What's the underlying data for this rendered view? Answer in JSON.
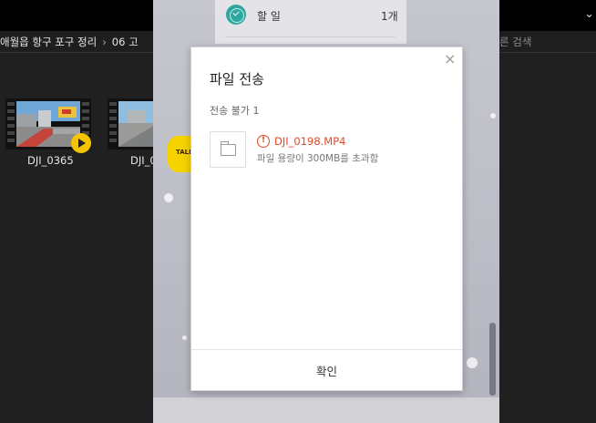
{
  "explorer": {
    "breadcrumb": [
      "애월읍 항구 포구 정리",
      "06 고"
    ],
    "breadcrumb_sep": "›",
    "search_placeholder": "른 검색",
    "top_chevron": "⌄",
    "files": [
      {
        "name": "DJI_0365",
        "type": "video"
      },
      {
        "name": "DJI_0",
        "type": "video"
      }
    ]
  },
  "chat": {
    "todo_label": "할 일",
    "todo_count": "1개",
    "kakao_badge": "TALK"
  },
  "dialog": {
    "title": "파일 전송",
    "fail_summary": "전송 불가 1",
    "close_glyph": "×",
    "warn_glyph": "!",
    "failed_file": {
      "name": "DJI_0198.MP4",
      "reason": "파일 용량이 300MB를 초과함"
    },
    "confirm_label": "확인"
  },
  "colors": {
    "error": "#e04a2a",
    "todo_teal": "#2ea7a0",
    "play_yellow": "#f5c400",
    "kakao_yellow": "#f5d200"
  }
}
